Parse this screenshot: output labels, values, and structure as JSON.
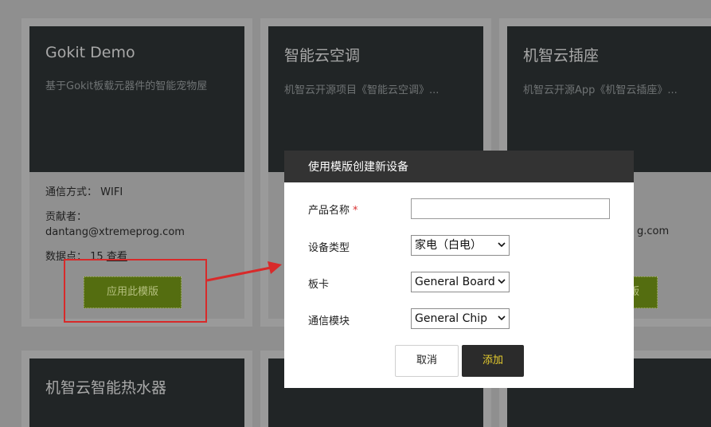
{
  "cards": [
    {
      "title": "Gokit Demo",
      "desc": "基于Gokit板载元器件的智能宠物屋",
      "comm_label": "通信方式：",
      "comm_value": "WIFI",
      "contrib_label": "贡献者：",
      "contrib_value": "dantang@xtremeprog.com",
      "datapoints_label": "数据点：",
      "datapoints_value": "15",
      "view_link": "查看",
      "apply_label": "应用此模版"
    },
    {
      "title": "智能云空调",
      "desc": "机智云开源项目《智能云空调》..."
    },
    {
      "title": "机智云插座",
      "desc": "机智云开源App《机智云插座》...",
      "contrib_partial": "g.com",
      "apply_partial": "版"
    },
    {
      "title": "机智云智能热水器"
    }
  ],
  "modal": {
    "title": "使用模版创建新设备",
    "product_name_label": "产品名称",
    "required_mark": "*",
    "product_name_value": "",
    "device_type_label": "设备类型",
    "device_type_value": "家电（白电）",
    "board_label": "板卡",
    "board_value": "General Board",
    "comm_module_label": "通信模块",
    "comm_module_value": "General Chip",
    "cancel_label": "取消",
    "add_label": "添加"
  },
  "colors": {
    "highlight": "#d82a2a",
    "apply_button": "#546d10",
    "add_text": "#e6cc2e"
  }
}
